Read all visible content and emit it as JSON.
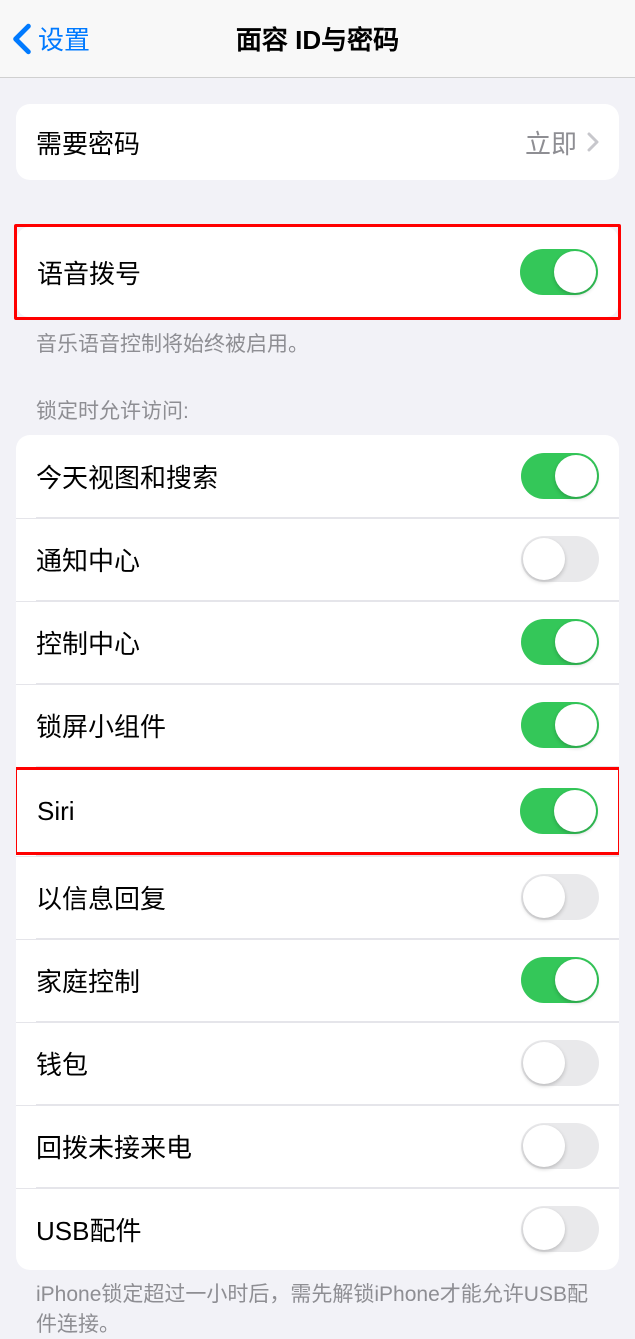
{
  "nav": {
    "back_label": "设置",
    "title": "面容 ID与密码"
  },
  "require_passcode": {
    "label": "需要密码",
    "value": "立即"
  },
  "voice_dial": {
    "label": "语音拨号",
    "footer": "音乐语音控制将始终被启用。"
  },
  "locked_access": {
    "header": "锁定时允许访问:",
    "items": [
      {
        "label": "今天视图和搜索",
        "on": true
      },
      {
        "label": "通知中心",
        "on": false
      },
      {
        "label": "控制中心",
        "on": true
      },
      {
        "label": "锁屏小组件",
        "on": true
      },
      {
        "label": "Siri",
        "on": true
      },
      {
        "label": "以信息回复",
        "on": false
      },
      {
        "label": "家庭控制",
        "on": true
      },
      {
        "label": "钱包",
        "on": false
      },
      {
        "label": "回拨未接来电",
        "on": false
      },
      {
        "label": "USB配件",
        "on": false
      }
    ],
    "footer": "iPhone锁定超过一小时后，需先解锁iPhone才能允许USB配件连接。"
  }
}
